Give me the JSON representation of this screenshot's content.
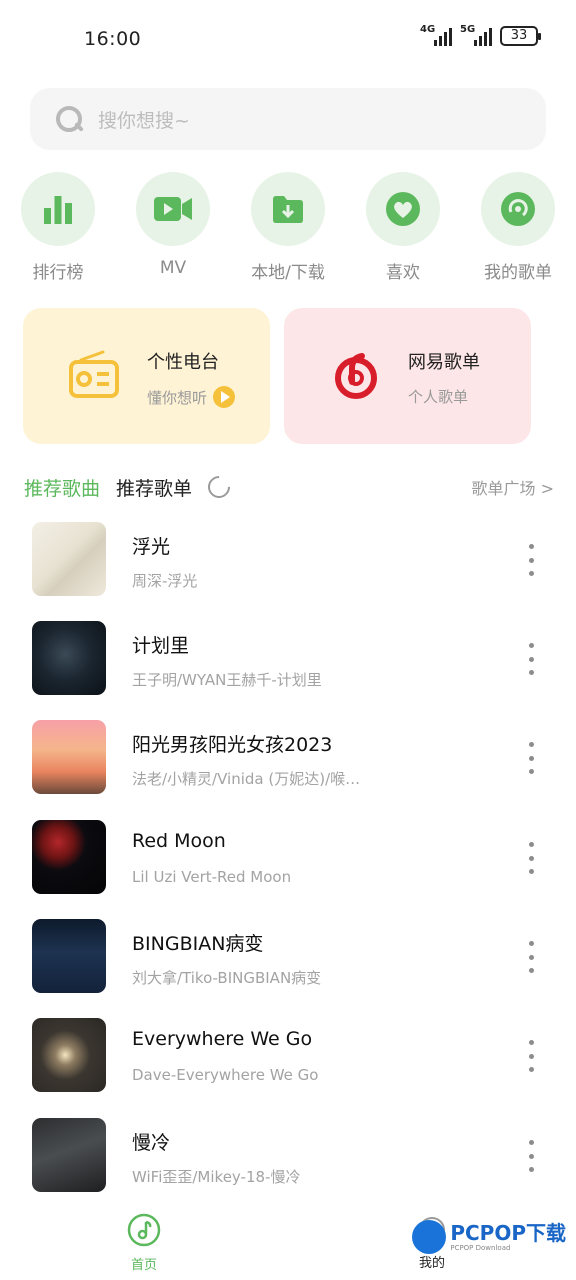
{
  "status_bar": {
    "time": "16:00",
    "net1": "4G",
    "net2": "5G",
    "battery": "33"
  },
  "search": {
    "placeholder": "搜你想搜~"
  },
  "quick_nav": [
    {
      "label": "排行榜",
      "icon": "chart-bars-icon"
    },
    {
      "label": "MV",
      "icon": "video-camera-icon"
    },
    {
      "label": "本地/下载",
      "icon": "folder-download-icon"
    },
    {
      "label": "喜欢",
      "icon": "heart-icon"
    },
    {
      "label": "我的歌单",
      "icon": "disc-icon"
    }
  ],
  "cards": {
    "radio": {
      "title": "个性电台",
      "subtitle": "懂你想听",
      "icon": "radio-icon"
    },
    "netease": {
      "title": "网易歌单",
      "subtitle": "个人歌单",
      "icon": "netease-logo-icon"
    }
  },
  "tabs": {
    "active": "推荐歌曲",
    "other": "推荐歌单",
    "plaza": "歌单广场 >"
  },
  "songs": [
    {
      "title": "浮光",
      "artist": "周深-浮光"
    },
    {
      "title": "计划里",
      "artist": "王子明/WYAN王赫千-计划里"
    },
    {
      "title": "阳光男孩阳光女孩2023",
      "artist": "法老/小精灵/Vinida (万妮达)/喉…"
    },
    {
      "title": "Red Moon",
      "artist": "Lil Uzi Vert-Red Moon"
    },
    {
      "title": "BINGBIAN病变",
      "artist": "刘大拿/Tiko-BINGBIAN病变"
    },
    {
      "title": "Everywhere We Go",
      "artist": "Dave-Everywhere We Go"
    },
    {
      "title": "慢冷",
      "artist": "WiFi歪歪/Mikey-18-慢冷"
    }
  ],
  "bottom_nav": {
    "home": "首页",
    "mine": "我的"
  },
  "watermark": {
    "text": "PCPOP下载",
    "sub": "PCPOP Download"
  },
  "colors": {
    "accent": "#5cb85c",
    "nav_bg": "#e7f3e6",
    "radio_card": "#fff3d6",
    "netease_card": "#fde6e8",
    "netease_red": "#d81e2a"
  }
}
